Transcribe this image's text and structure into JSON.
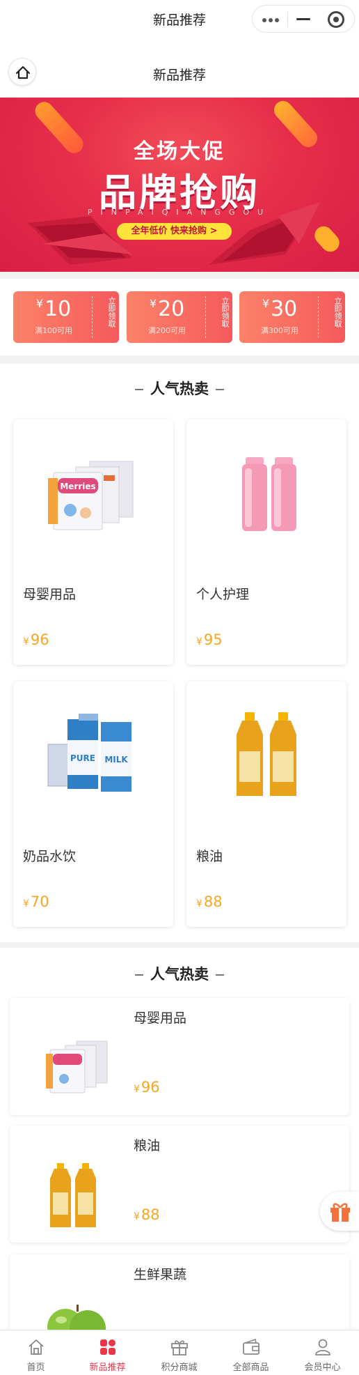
{
  "window": {
    "title": "新品推荐"
  },
  "nav": {
    "title": "新品推荐",
    "home_icon": "home-icon"
  },
  "banner": {
    "line1": "全场大促",
    "line2": "品牌抢购",
    "pinyin": "PINPAIQIANGGOU",
    "pill": "全年低价  快来抢购 >",
    "colors": {
      "background": "#e62d4a",
      "pill": "#ffe23a"
    }
  },
  "coupons": [
    {
      "symbol": "¥",
      "amount": "10",
      "condition": "满100可用",
      "action": "立即领取"
    },
    {
      "symbol": "¥",
      "amount": "20",
      "condition": "满200可用",
      "action": "立即领取"
    },
    {
      "symbol": "¥",
      "amount": "30",
      "condition": "满300可用",
      "action": "立即领取"
    }
  ],
  "section1": {
    "title": "人气热卖",
    "products": [
      {
        "name": "母婴用品",
        "symbol": "¥",
        "price": "96",
        "image": "diaper-pack-image"
      },
      {
        "name": "个人护理",
        "symbol": "¥",
        "price": "95",
        "image": "pink-bottles-image"
      },
      {
        "name": "奶品水饮",
        "symbol": "¥",
        "price": "70",
        "image": "milk-cartons-image"
      },
      {
        "name": "粮油",
        "symbol": "¥",
        "price": "88",
        "image": "oil-bottles-image"
      }
    ]
  },
  "section2": {
    "title": "人气热卖",
    "products": [
      {
        "name": "母婴用品",
        "symbol": "¥",
        "price": "96",
        "image": "diaper-pack-image"
      },
      {
        "name": "粮油",
        "symbol": "¥",
        "price": "88",
        "image": "oil-bottles-image"
      },
      {
        "name": "生鲜果蔬",
        "image": "green-apples-image"
      }
    ]
  },
  "tabbar": {
    "items": [
      {
        "label": "首页",
        "icon": "home-icon",
        "active": false
      },
      {
        "label": "新品推荐",
        "icon": "grid-icon",
        "active": true
      },
      {
        "label": "积分商城",
        "icon": "gift-icon",
        "active": false
      },
      {
        "label": "全部商品",
        "icon": "wallet-icon",
        "active": false
      },
      {
        "label": "会员中心",
        "icon": "user-icon",
        "active": false
      }
    ]
  },
  "colors": {
    "accent": "#e8364a",
    "price": "#f5a623",
    "coupon": "#f65a5c"
  }
}
